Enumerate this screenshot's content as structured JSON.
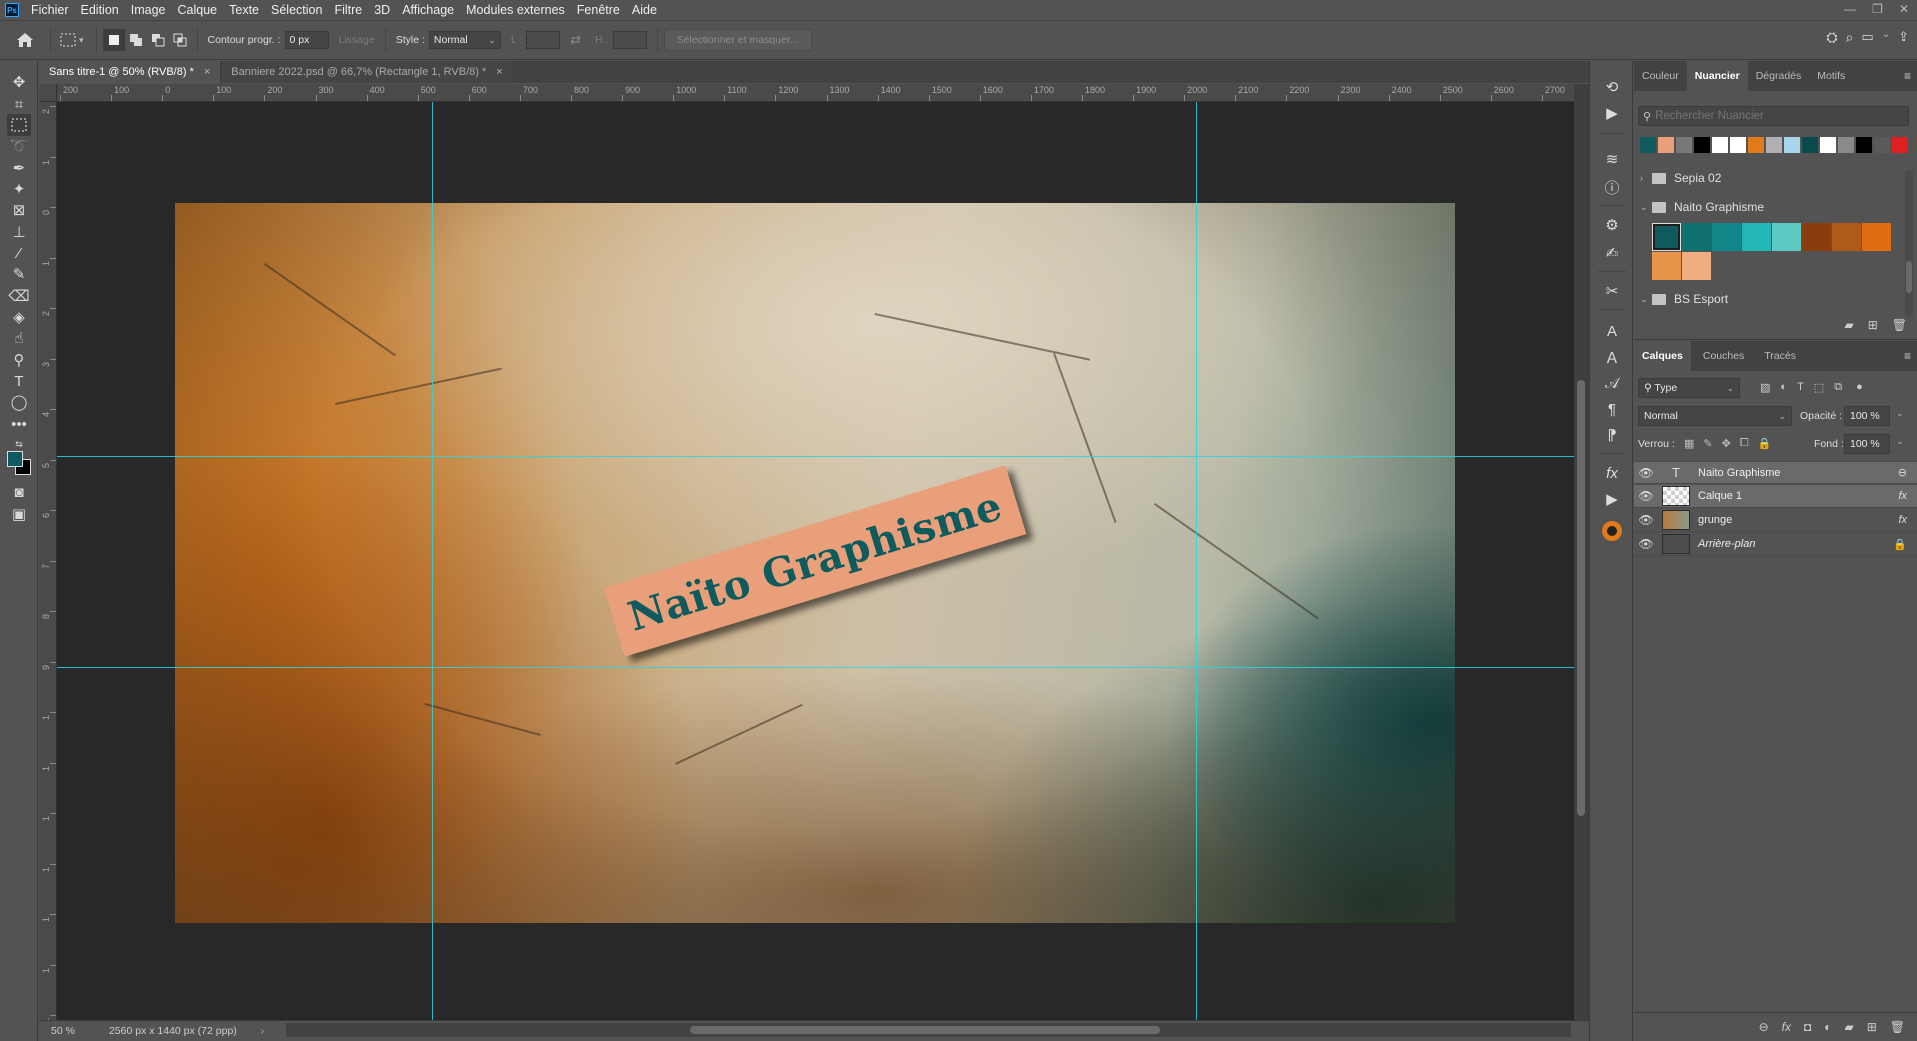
{
  "app": {
    "logo": "Ps"
  },
  "menu": [
    "Fichier",
    "Edition",
    "Image",
    "Calque",
    "Texte",
    "Sélection",
    "Filtre",
    "3D",
    "Affichage",
    "Modules externes",
    "Fenêtre",
    "Aide"
  ],
  "window_controls": {
    "minimize": "—",
    "restore": "❐",
    "close": "✕"
  },
  "options_bar": {
    "contour_label": "Contour progr. :",
    "contour_value": "0 px",
    "lissage_label": "Lissage",
    "style_label": "Style :",
    "style_value": "Normal",
    "l_label": "L :",
    "h_label": "H :",
    "select_mask_label": "Sélectionner et masquer..."
  },
  "doc_tabs": [
    {
      "label": "Sans titre-1 @ 50% (RVB/8) *",
      "close": "×",
      "active": true
    },
    {
      "label": "Banniere 2022.psd @ 66,7% (Rectangle 1, RVB/8) *",
      "close": "×",
      "active": false
    }
  ],
  "ruler_h_labels": [
    "200",
    "100",
    "0",
    "100",
    "200",
    "300",
    "400",
    "500",
    "600",
    "700",
    "800",
    "900",
    "1000",
    "1100",
    "1200",
    "1300",
    "1400",
    "1500",
    "1600",
    "1700",
    "1800",
    "1900",
    "2000",
    "2100",
    "2200",
    "2300",
    "2400",
    "2500",
    "2600",
    "2700"
  ],
  "ruler_v_labels": [
    "2",
    "1",
    "0",
    "1",
    "2",
    "3",
    "4",
    "5",
    "6",
    "7",
    "8",
    "9",
    "1",
    "1",
    "1",
    "1",
    "1",
    "1",
    "1",
    "1"
  ],
  "artwork": {
    "label_text": "Naïto Graphisme",
    "label_bg": "#e9a07a",
    "label_color": "#0e5a5c"
  },
  "status": {
    "zoom": "50 %",
    "doc_info": "2560 px x 1440 px (72 ppp)",
    "arrow": "›"
  },
  "swatches_panel": {
    "tabs": [
      "Couleur",
      "Nuancier",
      "Dégradés",
      "Motifs"
    ],
    "active_tab": "Nuancier",
    "search_placeholder": "Rechercher Nuancier",
    "recent_colors": [
      "#0e5a5c",
      "#e9a07a",
      "#777777",
      "#000000",
      "#ffffff",
      "#ffffff",
      "#e07a1a",
      "#b0b0b0",
      "#a8d4ec",
      "#0b4a4c",
      "#ffffff",
      "#8a8a8a",
      "#000000",
      "#5a5a5a",
      "#e02020"
    ],
    "groups": [
      {
        "name": "Sepia 02",
        "expanded": false
      },
      {
        "name": "Naito Graphisme",
        "expanded": true
      },
      {
        "name": "BS Esport",
        "expanded": true
      }
    ],
    "naito_colors": [
      "#0e5a5c",
      "#107070",
      "#12878a",
      "#22b7b7",
      "#5ccac4",
      "#8a3d0c",
      "#b05a1a",
      "#e06d10",
      "#e8944a",
      "#f0ae80"
    ]
  },
  "layers_panel": {
    "tabs": [
      "Calques",
      "Couches",
      "Tracés"
    ],
    "active_tab": "Calques",
    "filter_label": "Type",
    "blend_mode": "Normal",
    "opacity_label": "Opacité :",
    "opacity_value": "100 %",
    "lock_label": "Verrou :",
    "fill_label": "Fond :",
    "fill_value": "100 %",
    "layers": [
      {
        "name": "Naito Graphisme",
        "kind": "text",
        "selected": true,
        "badge": "⊖"
      },
      {
        "name": "Calque 1",
        "kind": "pixel",
        "selected": true,
        "badge": "fx"
      },
      {
        "name": "grunge",
        "kind": "smart",
        "selected": false,
        "badge": "fx"
      },
      {
        "name": "Arrière-plan",
        "kind": "background",
        "selected": false,
        "badge": "🔒"
      }
    ]
  }
}
